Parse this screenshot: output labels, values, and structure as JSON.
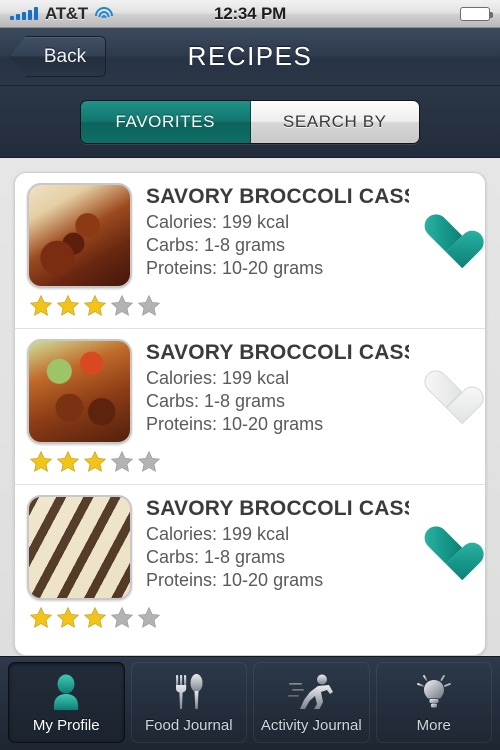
{
  "status_bar": {
    "carrier": "AT&T",
    "time": "12:34 PM",
    "signal_icon": "signal-bars-icon",
    "wifi_icon": "wifi-icon",
    "battery_icon": "battery-icon"
  },
  "nav_bar": {
    "back_label": "Back",
    "title": "RECIPES"
  },
  "segmented_control": {
    "options": [
      {
        "label": "FAVORITES",
        "selected": true
      },
      {
        "label": "SEARCH BY",
        "selected": false
      }
    ],
    "selected_color": "#12766f"
  },
  "recipes": [
    {
      "title": "SAVORY BROCCOLI CASS...",
      "calories": "Calories: 199 kcal",
      "carbs": "Carbs: 1-8 grams",
      "proteins": "Proteins: 10-20 grams",
      "rating": 3,
      "max_rating": 5,
      "favorite": true,
      "thumb_class": "a1"
    },
    {
      "title": "SAVORY BROCCOLI CASS...",
      "calories": "Calories: 199 kcal",
      "carbs": "Carbs: 1-8 grams",
      "proteins": "Proteins: 10-20 grams",
      "rating": 3,
      "max_rating": 5,
      "favorite": false,
      "thumb_class": "a2"
    },
    {
      "title": "SAVORY BROCCOLI CASS...",
      "calories": "Calories: 199 kcal",
      "carbs": "Carbs: 1-8 grams",
      "proteins": "Proteins: 10-20 grams",
      "rating": 3,
      "max_rating": 5,
      "favorite": true,
      "thumb_class": "a3"
    }
  ],
  "tab_bar": {
    "tabs": [
      {
        "label": "My Profile",
        "icon": "person-icon",
        "selected": true
      },
      {
        "label": "Food Journal",
        "icon": "utensils-icon",
        "selected": false
      },
      {
        "label": "Activity Journal",
        "icon": "runner-icon",
        "selected": false
      },
      {
        "label": "More",
        "icon": "lightbulb-icon",
        "selected": false
      }
    ]
  },
  "colors": {
    "accent_teal": "#17998c",
    "star_gold": "#f0c419",
    "star_gray": "#b3b3b3",
    "nav_navy": "#2e3b4d"
  }
}
